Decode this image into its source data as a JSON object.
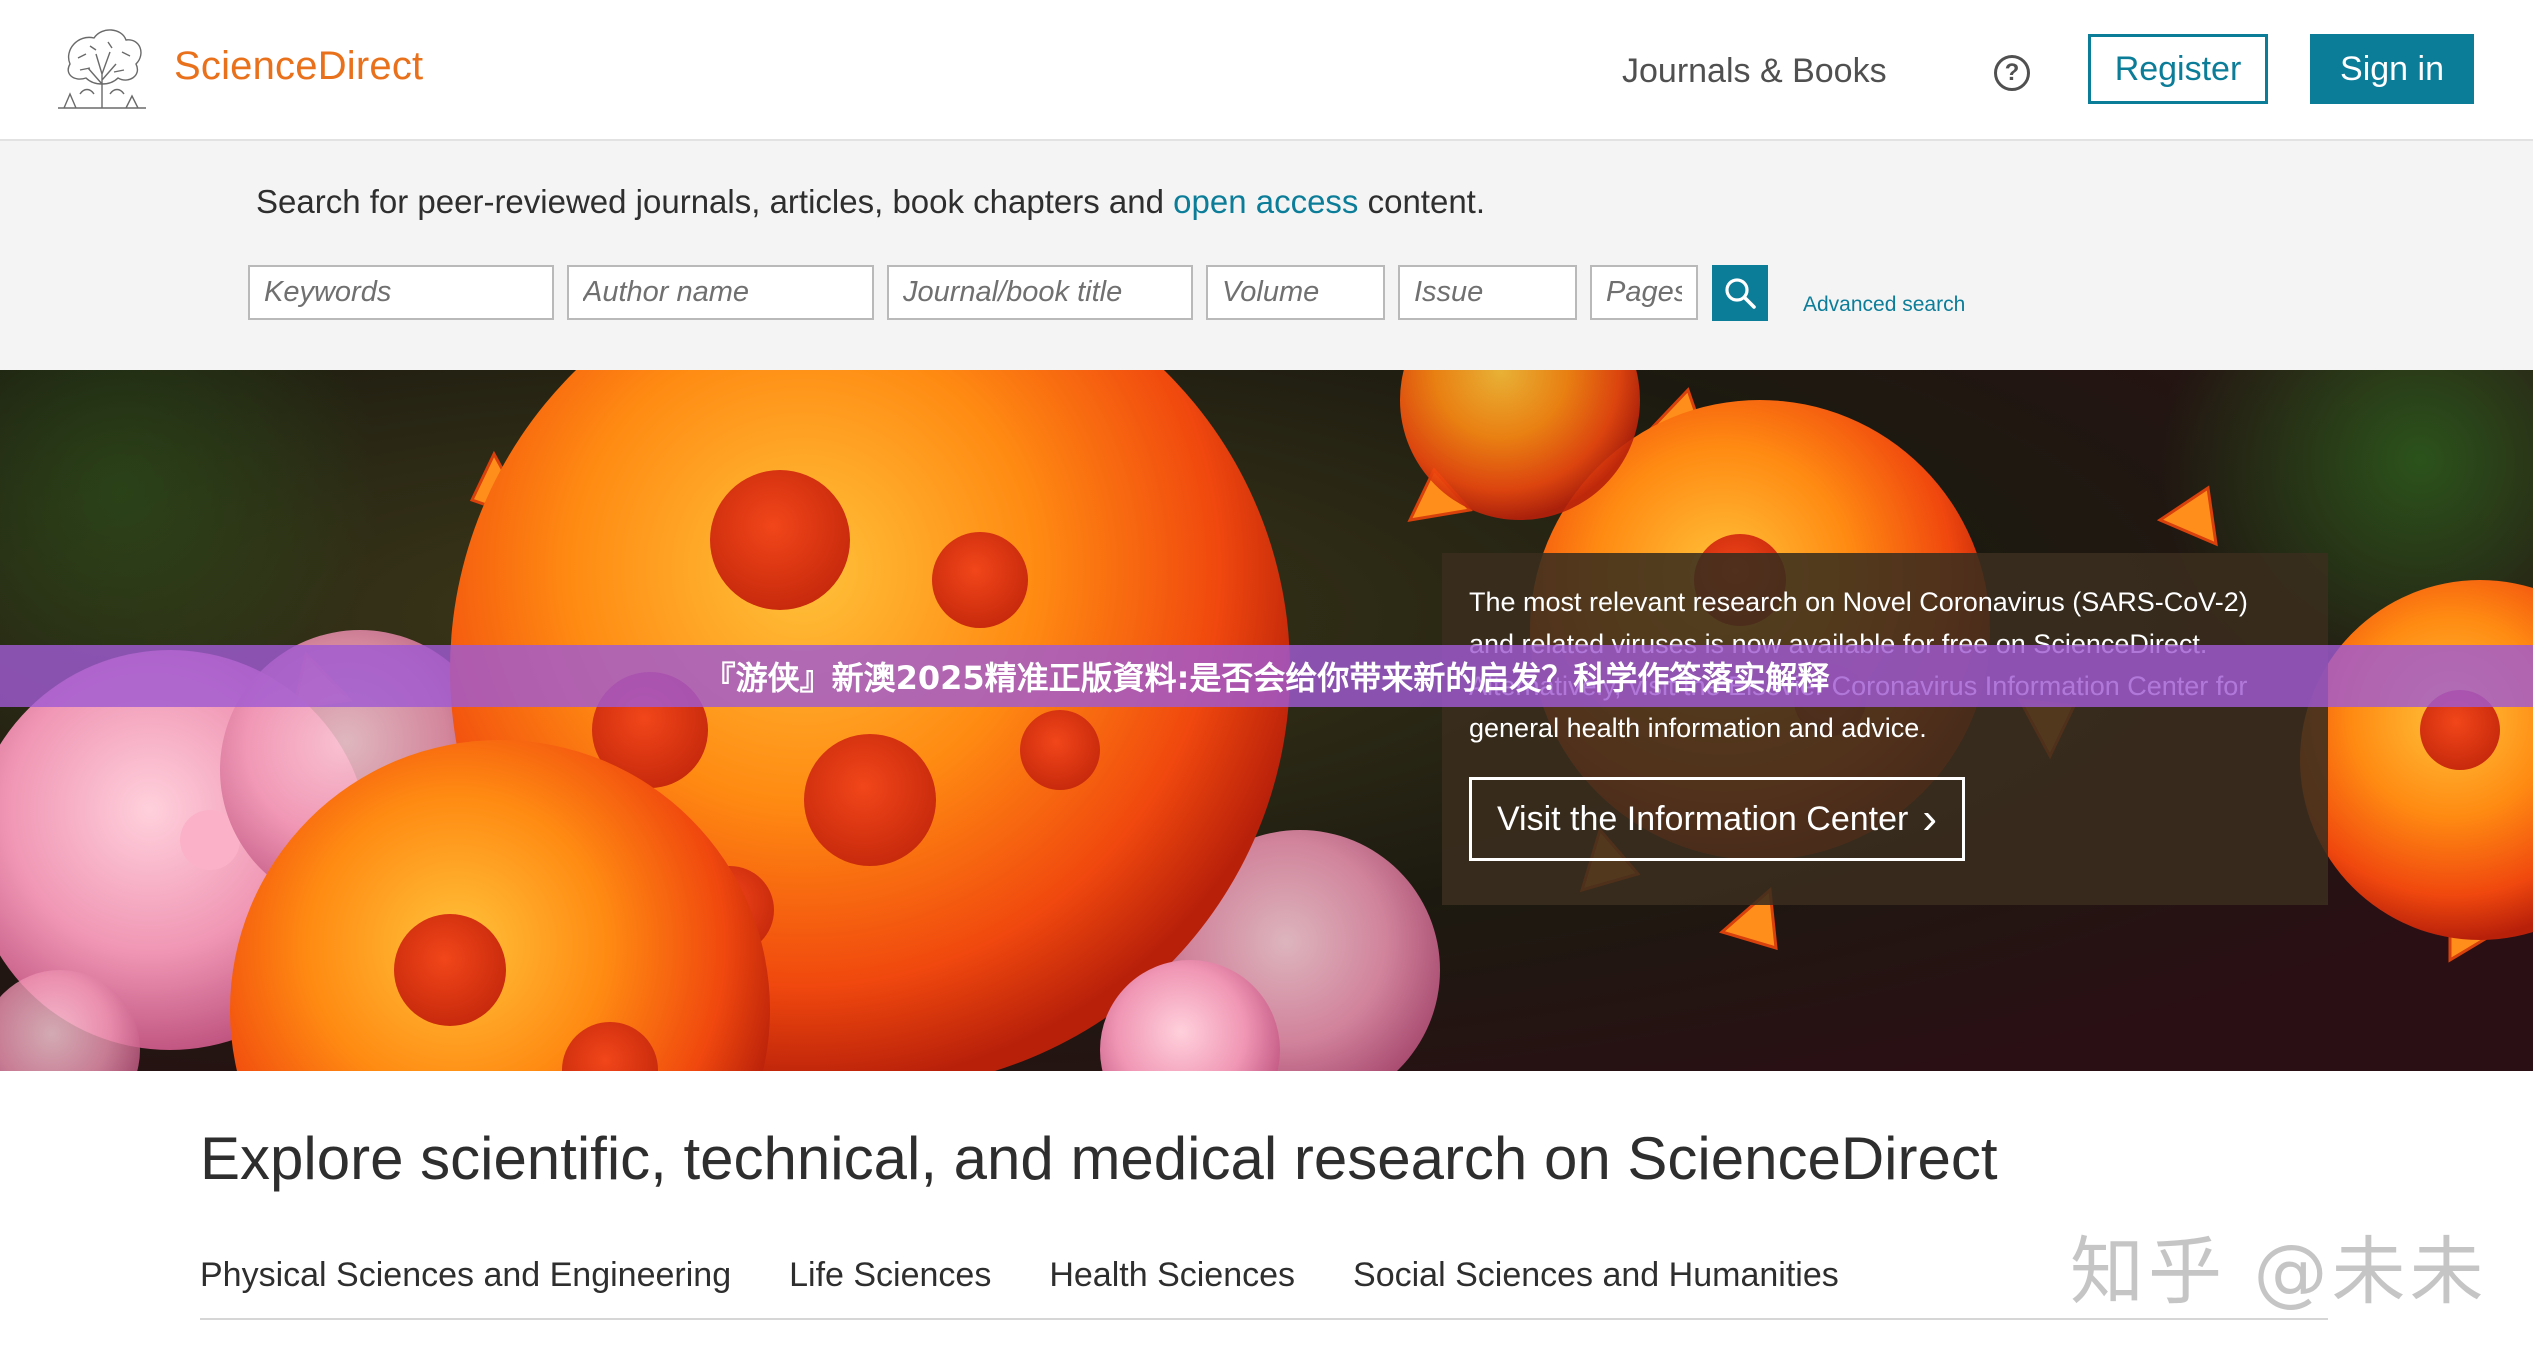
{
  "header": {
    "brand": "ScienceDirect",
    "journals_books": "Journals & Books",
    "help_glyph": "?",
    "register_label": "Register",
    "signin_label": "Sign in"
  },
  "search": {
    "intro_prefix": "Search for peer-reviewed journals, articles, book chapters and ",
    "intro_link": "open access",
    "intro_suffix": " content.",
    "keywords_placeholder": "Keywords",
    "author_placeholder": "Author name",
    "journal_placeholder": "Journal/book title",
    "volume_placeholder": "Volume",
    "issue_placeholder": "Issue",
    "pages_placeholder": "Pages",
    "advanced_label": "Advanced search"
  },
  "hero": {
    "info_text": "The most relevant research on Novel Coronavirus (SARS-CoV-2) and related viruses is now available for free on ScienceDirect. Alternatively, visit the Elsevier Coronavirus Information Center for general health information and advice.",
    "button_label": "Visit the Information Center",
    "button_chevron": "›"
  },
  "overlay_banner": "『游侠』新澳2025精准正版資料:是否会给你带来新的启发？科学作答落实解释",
  "explore": {
    "title": "Explore scientific, technical, and medical research on ScienceDirect",
    "tabs": [
      "Physical Sciences and Engineering",
      "Life Sciences",
      "Health Sciences",
      "Social Sciences and Humanities"
    ]
  },
  "watermark": "知乎 @未未",
  "colors": {
    "brand_orange": "#e9711c",
    "accent_teal": "#0c7d99",
    "search_band_bg": "#f4f4f4",
    "banner_purple": "#a05ad2"
  },
  "icons": {
    "logo": "elsevier-tree-logo",
    "help": "question-circle-icon",
    "search": "magnifier-icon",
    "chevron": "chevron-right-icon"
  }
}
